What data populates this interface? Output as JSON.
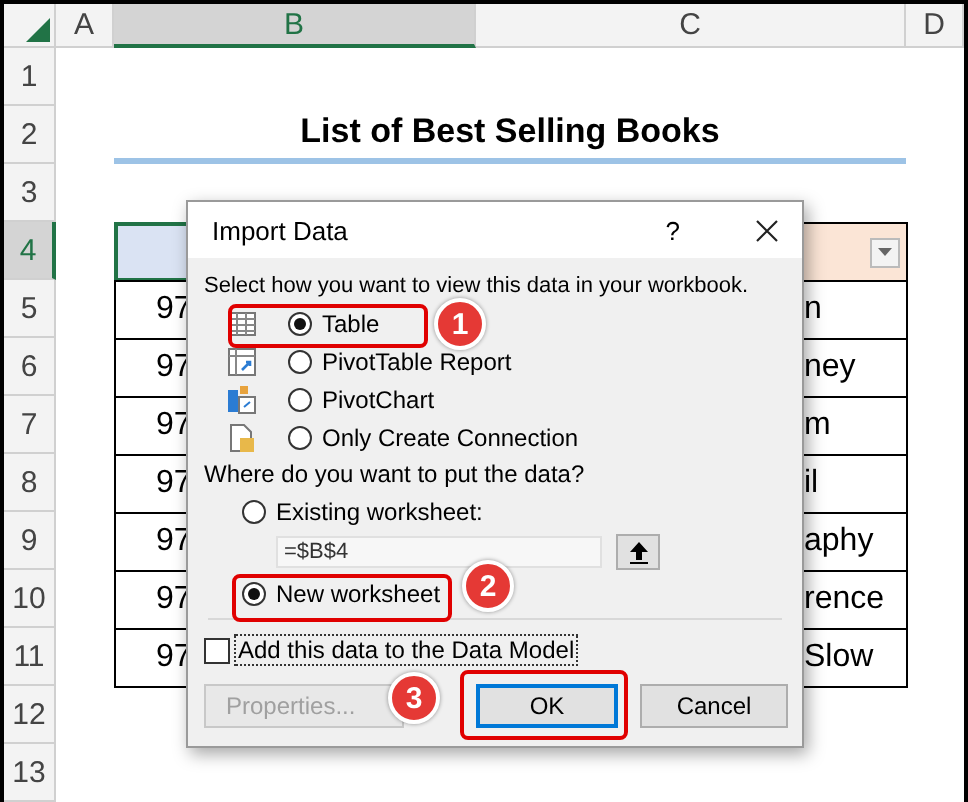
{
  "sheet": {
    "columns": [
      {
        "label": "A",
        "selected": false
      },
      {
        "label": "B",
        "selected": true
      },
      {
        "label": "C",
        "selected": false
      },
      {
        "label": "D",
        "selected": false
      }
    ],
    "rows": [
      {
        "label": "1",
        "selected": false
      },
      {
        "label": "2",
        "selected": false
      },
      {
        "label": "3",
        "selected": false
      },
      {
        "label": "4",
        "selected": true
      },
      {
        "label": "5",
        "selected": false
      },
      {
        "label": "6",
        "selected": false
      },
      {
        "label": "7",
        "selected": false
      },
      {
        "label": "8",
        "selected": false
      },
      {
        "label": "9",
        "selected": false
      },
      {
        "label": "10",
        "selected": false
      },
      {
        "label": "11",
        "selected": false
      },
      {
        "label": "12",
        "selected": false
      },
      {
        "label": "13",
        "selected": false
      }
    ],
    "title": "List of Best Selling Books",
    "table": {
      "rows": [
        [
          "97",
          "n"
        ],
        [
          "97",
          "ney"
        ],
        [
          "97",
          "m"
        ],
        [
          "97",
          "il"
        ],
        [
          "97",
          "aphy"
        ],
        [
          "97",
          "rence"
        ],
        [
          "97",
          "Slow"
        ]
      ]
    }
  },
  "dialog": {
    "title": "Import Data",
    "help": "?",
    "view_prompt": "Select how you want to view this data in your workbook.",
    "view_options": [
      {
        "label": "Table",
        "kind": "table",
        "selected": true
      },
      {
        "label": "PivotTable Report",
        "kind": "pivottable",
        "selected": false
      },
      {
        "label": "PivotChart",
        "kind": "pivotchart",
        "selected": false
      },
      {
        "label": "Only Create Connection",
        "kind": "connection",
        "selected": false
      }
    ],
    "place_prompt": "Where do you want to put the data?",
    "place_options": [
      {
        "label": "Existing worksheet:",
        "selected": false,
        "range_field": {
          "value": "=$B$4",
          "disabled": true
        }
      },
      {
        "label": "New worksheet",
        "selected": true
      }
    ],
    "data_model": {
      "label": "Add this data to the Data Model",
      "checked": false
    },
    "buttons": [
      {
        "label": "Properties...",
        "kind": "menu",
        "disabled": true
      },
      {
        "label": "OK",
        "kind": "default",
        "disabled": false
      },
      {
        "label": "Cancel",
        "kind": "normal",
        "disabled": false
      }
    ]
  },
  "annotations": [
    {
      "label": "1"
    },
    {
      "label": "2"
    },
    {
      "label": "3"
    }
  ]
}
